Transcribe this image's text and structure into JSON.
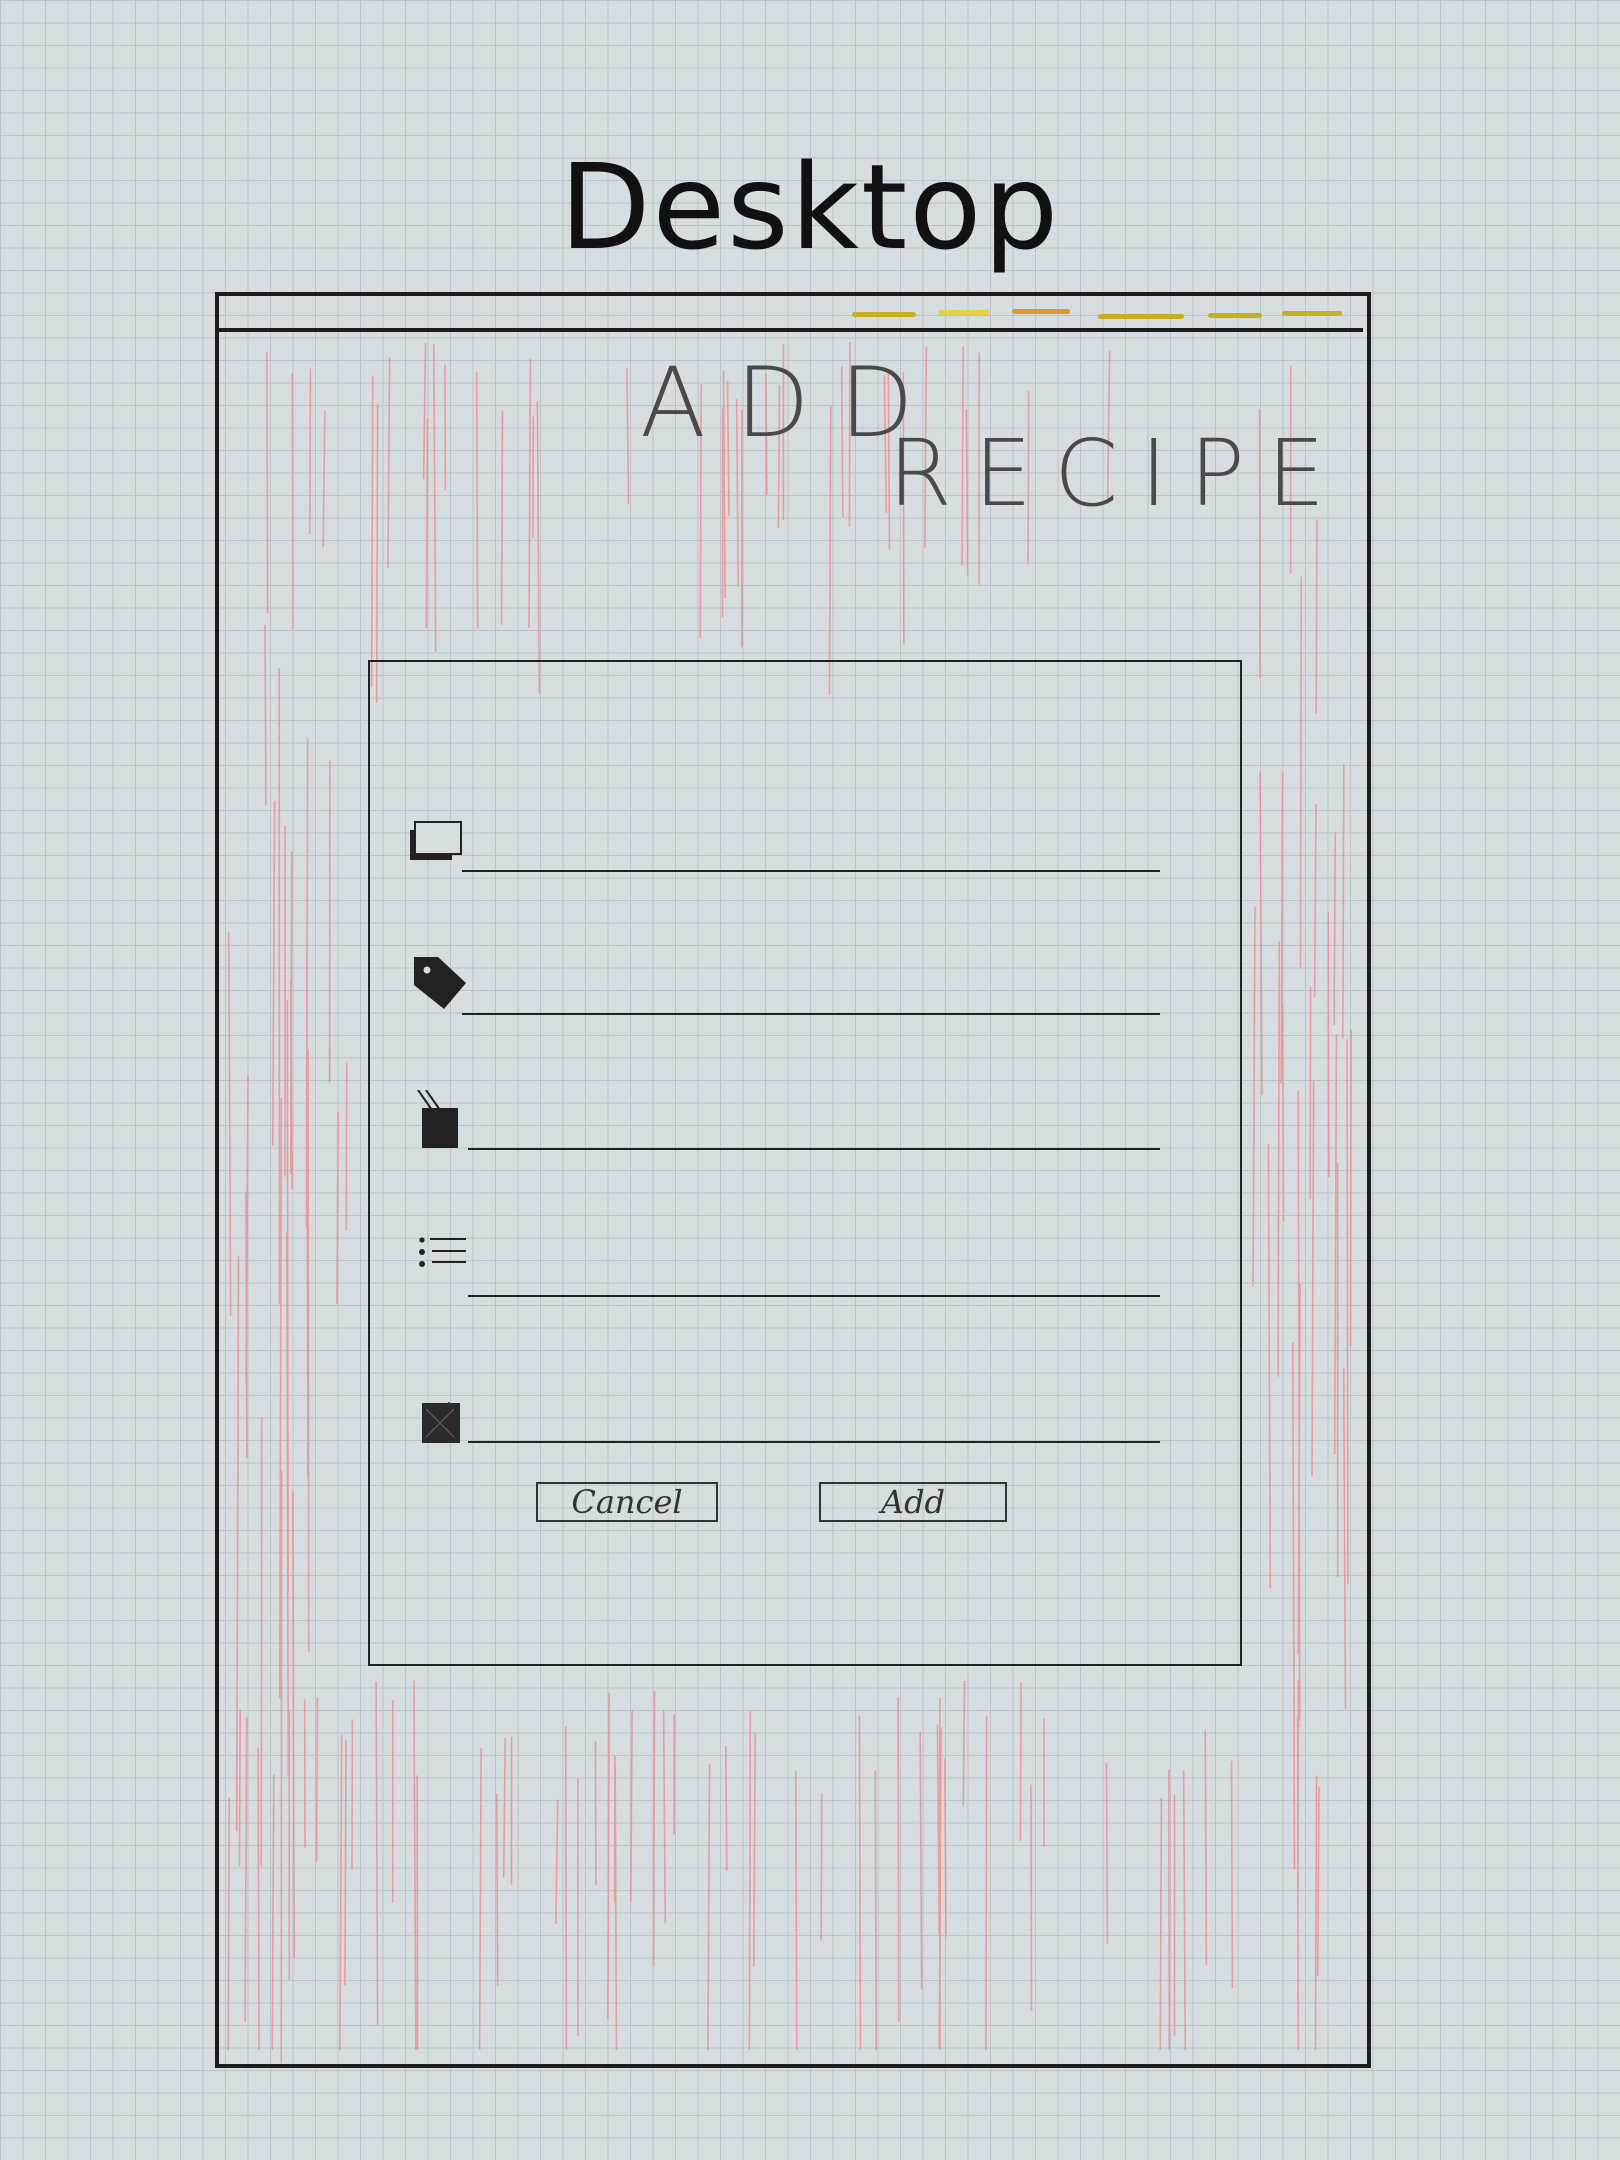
{
  "title": "Desktop",
  "heading": {
    "line1": "ADD",
    "line2": "RECIPE"
  },
  "tab_dash_colors": [
    "#c9b022",
    "#e3d147",
    "#e2982e",
    "#c9b022",
    "#c9b022",
    "#c9b022"
  ],
  "form": {
    "fields": [
      {
        "name": "recipe-name",
        "icon": "window-icon",
        "value": ""
      },
      {
        "name": "tag",
        "icon": "tag-icon",
        "value": ""
      },
      {
        "name": "cooking-pot",
        "icon": "pot-icon",
        "value": ""
      },
      {
        "name": "ingredients-list",
        "icon": "list-icon",
        "value": ""
      },
      {
        "name": "image",
        "icon": "image-icon",
        "value": ""
      }
    ],
    "cancel_label": "Cancel",
    "add_label": "Add"
  },
  "colors": {
    "background": "#d5dde1",
    "grid": "#b9c3c9",
    "hatch": "#e88a8a",
    "ink": "#1c1c1c"
  }
}
